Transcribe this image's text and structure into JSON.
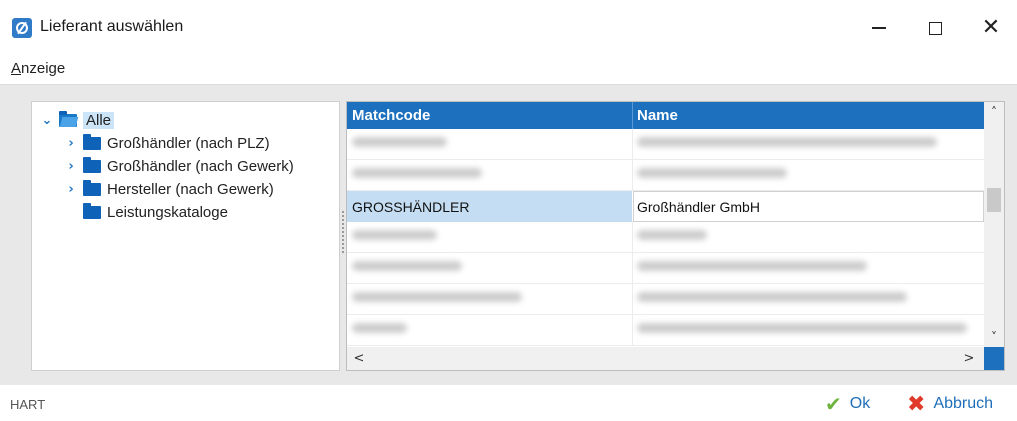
{
  "window": {
    "title": "Lieferant auswählen",
    "minimize_glyph": "—",
    "maximize_glyph": "☐",
    "close_glyph": "✕"
  },
  "menu": {
    "items": [
      {
        "accel": "A",
        "rest": "nzeige"
      }
    ]
  },
  "tree": {
    "items": [
      {
        "label": "Alle",
        "expanded": true,
        "selected": true,
        "icon": "folder-open-icon"
      },
      {
        "label": "Großhändler (nach PLZ)",
        "expanded": false,
        "icon": "folder-icon"
      },
      {
        "label": "Großhändler (nach Gewerk)",
        "expanded": false,
        "icon": "folder-icon"
      },
      {
        "label": "Hersteller (nach Gewerk)",
        "expanded": false,
        "icon": "folder-icon"
      },
      {
        "label": "Leistungskataloge",
        "expanded": false,
        "icon": "folder-icon"
      }
    ]
  },
  "grid": {
    "columns": [
      "Matchcode",
      "Name"
    ],
    "rows": [
      {
        "matchcode": "",
        "name": "",
        "blurred": true
      },
      {
        "matchcode": "",
        "name": "",
        "blurred": true
      },
      {
        "matchcode": "GROSSHÄNDLER",
        "name": "Großhändler GmbH",
        "blurred": false,
        "selected": true
      },
      {
        "matchcode": "",
        "name": "",
        "blurred": true
      },
      {
        "matchcode": "",
        "name": "",
        "blurred": true
      },
      {
        "matchcode": "",
        "name": "",
        "blurred": true
      },
      {
        "matchcode": "",
        "name": "",
        "blurred": true
      }
    ],
    "scroll_up": "˄",
    "scroll_down": "˅",
    "scroll_left": "<",
    "scroll_right": ">"
  },
  "footer": {
    "label": "HART",
    "ok_label": "Ok",
    "cancel_label": "Abbruch"
  },
  "colors": {
    "accent": "#1c70bd",
    "ok_check": "#6fb43f",
    "cancel_x": "#e03a2a",
    "selection": "#c4ddf2"
  }
}
